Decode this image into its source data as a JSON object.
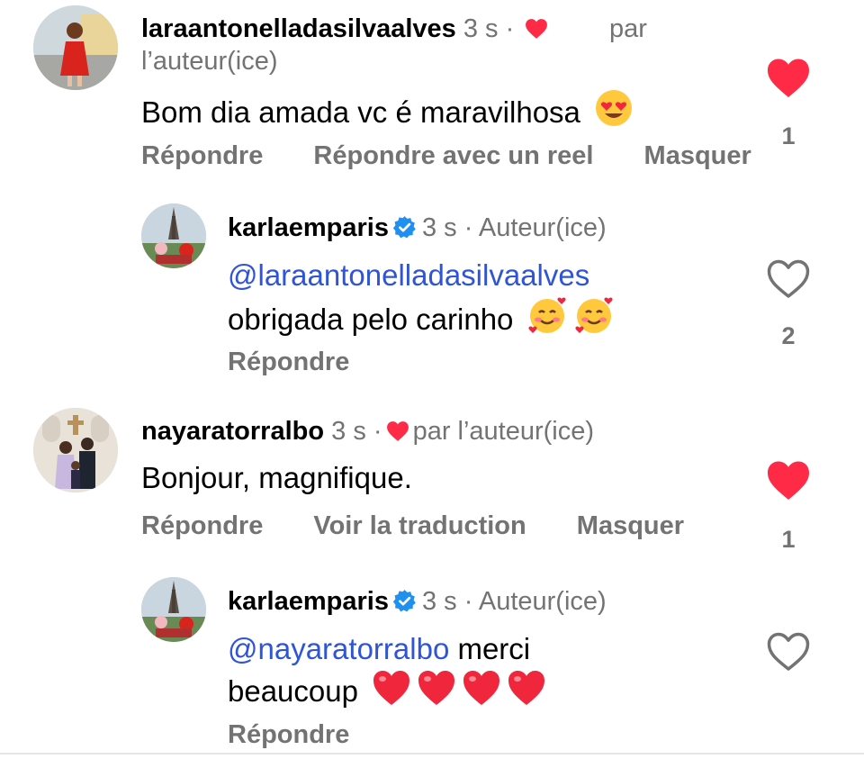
{
  "comments": [
    {
      "username": "laraantonelladasilvaalves",
      "time": "3 s",
      "liked_by_author": "par l’auteur(ice)",
      "text": "Bom dia amada vc é maravilhosa",
      "actions": [
        "Répondre",
        "Répondre avec un reel",
        "Masquer"
      ],
      "like_count": "1",
      "liked": true
    },
    {
      "username": "karlaemparis",
      "time": "3 s",
      "role": "Auteur(ice)",
      "mention": "@laraantonelladasilvaalves",
      "text": "obrigada pelo carinho",
      "actions": [
        "Répondre"
      ],
      "like_count": "2",
      "liked": false
    },
    {
      "username": "nayaratorralbo",
      "time": "3 s",
      "liked_by_author": "par l’auteur(ice)",
      "text": "Bonjour, magnifique.",
      "actions": [
        "Répondre",
        "Voir la traduction",
        "Masquer"
      ],
      "like_count": "1",
      "liked": true
    },
    {
      "username": "karlaemparis",
      "time": "3 s",
      "role": "Auteur(ice)",
      "mention": "@nayaratorralbo",
      "text_line1": "merci",
      "text_line2": "beaucoup",
      "actions": [
        "Répondre"
      ],
      "liked": false
    }
  ],
  "colors": {
    "like_red": "#ff2a46",
    "verified_blue": "#1f8ff0",
    "mention_blue": "#2f54d6",
    "secondary_gray": "#737373"
  },
  "icons": [
    "heart-filled-icon",
    "heart-outline-icon",
    "verified-badge-icon",
    "small-heart-icon",
    "heart-eyes-emoji",
    "smiling-hearts-emoji",
    "red-heart-emoji"
  ]
}
